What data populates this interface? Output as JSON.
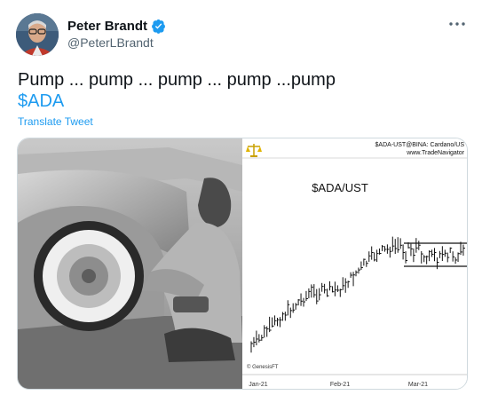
{
  "author": {
    "display_name": "Peter Brandt",
    "handle": "@PeterLBrandt",
    "verified": true
  },
  "tweet": {
    "text_line1": "Pump ... pump ... pump ... pump ...pump",
    "cashtag": "$ADA",
    "translate_label": "Translate Tweet"
  },
  "media_chart": {
    "header_symbol": "$ADA-UST@BINA: Cardano/US",
    "header_site": "www.TradeNavigator",
    "title": "$ADA/UST",
    "watermark": "© GenesisFT",
    "x_ticks": [
      "Jan-21",
      "Feb-21",
      "Mar-21"
    ],
    "colors": {
      "bars": "#111111",
      "box": "#111111"
    }
  },
  "icons": {
    "verified": "verified-badge-icon",
    "more": "more-dots-icon",
    "chart_logo": "scales-logo-icon"
  }
}
